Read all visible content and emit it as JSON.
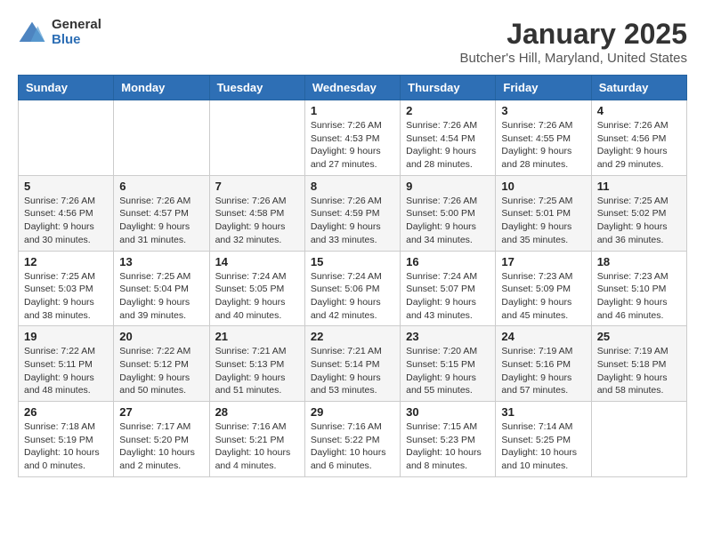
{
  "header": {
    "logo_general": "General",
    "logo_blue": "Blue",
    "title": "January 2025",
    "subtitle": "Butcher's Hill, Maryland, United States"
  },
  "weekdays": [
    "Sunday",
    "Monday",
    "Tuesday",
    "Wednesday",
    "Thursday",
    "Friday",
    "Saturday"
  ],
  "weeks": [
    [
      {
        "day": "",
        "info": ""
      },
      {
        "day": "",
        "info": ""
      },
      {
        "day": "",
        "info": ""
      },
      {
        "day": "1",
        "info": "Sunrise: 7:26 AM\nSunset: 4:53 PM\nDaylight: 9 hours\nand 27 minutes."
      },
      {
        "day": "2",
        "info": "Sunrise: 7:26 AM\nSunset: 4:54 PM\nDaylight: 9 hours\nand 28 minutes."
      },
      {
        "day": "3",
        "info": "Sunrise: 7:26 AM\nSunset: 4:55 PM\nDaylight: 9 hours\nand 28 minutes."
      },
      {
        "day": "4",
        "info": "Sunrise: 7:26 AM\nSunset: 4:56 PM\nDaylight: 9 hours\nand 29 minutes."
      }
    ],
    [
      {
        "day": "5",
        "info": "Sunrise: 7:26 AM\nSunset: 4:56 PM\nDaylight: 9 hours\nand 30 minutes."
      },
      {
        "day": "6",
        "info": "Sunrise: 7:26 AM\nSunset: 4:57 PM\nDaylight: 9 hours\nand 31 minutes."
      },
      {
        "day": "7",
        "info": "Sunrise: 7:26 AM\nSunset: 4:58 PM\nDaylight: 9 hours\nand 32 minutes."
      },
      {
        "day": "8",
        "info": "Sunrise: 7:26 AM\nSunset: 4:59 PM\nDaylight: 9 hours\nand 33 minutes."
      },
      {
        "day": "9",
        "info": "Sunrise: 7:26 AM\nSunset: 5:00 PM\nDaylight: 9 hours\nand 34 minutes."
      },
      {
        "day": "10",
        "info": "Sunrise: 7:25 AM\nSunset: 5:01 PM\nDaylight: 9 hours\nand 35 minutes."
      },
      {
        "day": "11",
        "info": "Sunrise: 7:25 AM\nSunset: 5:02 PM\nDaylight: 9 hours\nand 36 minutes."
      }
    ],
    [
      {
        "day": "12",
        "info": "Sunrise: 7:25 AM\nSunset: 5:03 PM\nDaylight: 9 hours\nand 38 minutes."
      },
      {
        "day": "13",
        "info": "Sunrise: 7:25 AM\nSunset: 5:04 PM\nDaylight: 9 hours\nand 39 minutes."
      },
      {
        "day": "14",
        "info": "Sunrise: 7:24 AM\nSunset: 5:05 PM\nDaylight: 9 hours\nand 40 minutes."
      },
      {
        "day": "15",
        "info": "Sunrise: 7:24 AM\nSunset: 5:06 PM\nDaylight: 9 hours\nand 42 minutes."
      },
      {
        "day": "16",
        "info": "Sunrise: 7:24 AM\nSunset: 5:07 PM\nDaylight: 9 hours\nand 43 minutes."
      },
      {
        "day": "17",
        "info": "Sunrise: 7:23 AM\nSunset: 5:09 PM\nDaylight: 9 hours\nand 45 minutes."
      },
      {
        "day": "18",
        "info": "Sunrise: 7:23 AM\nSunset: 5:10 PM\nDaylight: 9 hours\nand 46 minutes."
      }
    ],
    [
      {
        "day": "19",
        "info": "Sunrise: 7:22 AM\nSunset: 5:11 PM\nDaylight: 9 hours\nand 48 minutes."
      },
      {
        "day": "20",
        "info": "Sunrise: 7:22 AM\nSunset: 5:12 PM\nDaylight: 9 hours\nand 50 minutes."
      },
      {
        "day": "21",
        "info": "Sunrise: 7:21 AM\nSunset: 5:13 PM\nDaylight: 9 hours\nand 51 minutes."
      },
      {
        "day": "22",
        "info": "Sunrise: 7:21 AM\nSunset: 5:14 PM\nDaylight: 9 hours\nand 53 minutes."
      },
      {
        "day": "23",
        "info": "Sunrise: 7:20 AM\nSunset: 5:15 PM\nDaylight: 9 hours\nand 55 minutes."
      },
      {
        "day": "24",
        "info": "Sunrise: 7:19 AM\nSunset: 5:16 PM\nDaylight: 9 hours\nand 57 minutes."
      },
      {
        "day": "25",
        "info": "Sunrise: 7:19 AM\nSunset: 5:18 PM\nDaylight: 9 hours\nand 58 minutes."
      }
    ],
    [
      {
        "day": "26",
        "info": "Sunrise: 7:18 AM\nSunset: 5:19 PM\nDaylight: 10 hours\nand 0 minutes."
      },
      {
        "day": "27",
        "info": "Sunrise: 7:17 AM\nSunset: 5:20 PM\nDaylight: 10 hours\nand 2 minutes."
      },
      {
        "day": "28",
        "info": "Sunrise: 7:16 AM\nSunset: 5:21 PM\nDaylight: 10 hours\nand 4 minutes."
      },
      {
        "day": "29",
        "info": "Sunrise: 7:16 AM\nSunset: 5:22 PM\nDaylight: 10 hours\nand 6 minutes."
      },
      {
        "day": "30",
        "info": "Sunrise: 7:15 AM\nSunset: 5:23 PM\nDaylight: 10 hours\nand 8 minutes."
      },
      {
        "day": "31",
        "info": "Sunrise: 7:14 AM\nSunset: 5:25 PM\nDaylight: 10 hours\nand 10 minutes."
      },
      {
        "day": "",
        "info": ""
      }
    ]
  ]
}
